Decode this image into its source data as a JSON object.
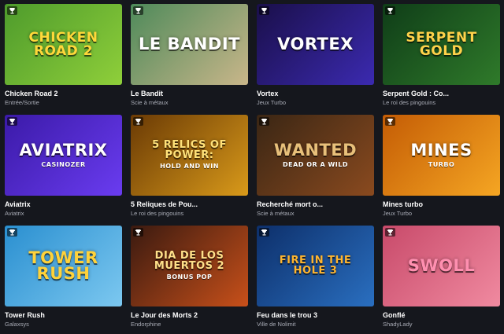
{
  "games": [
    {
      "title": "Chicken Road 2",
      "provider": "Entrée/Sortie",
      "art_text": "Chicken Road 2",
      "icon": "trophy-icon",
      "bg": "#4e9b2c",
      "bg2": "#8fcf3a",
      "fg": "#ffd83a"
    },
    {
      "title": "Le Bandit",
      "provider": "Scie à métaux",
      "art_text": "Le Bandit",
      "icon": "trophy-icon",
      "bg": "#4e8a5a",
      "bg2": "#c9b68a",
      "fg": "#ffffff"
    },
    {
      "title": "Vortex",
      "provider": "Jeux Turbo",
      "art_text": "Vortex",
      "icon": "trophy-icon",
      "bg": "#1a0f4a",
      "bg2": "#3b2ab0",
      "fg": "#ffffff"
    },
    {
      "title": "Serpent Gold : Co...",
      "provider": "Le roi des pingouins",
      "art_text": "Serpent Gold",
      "icon": "trophy-icon",
      "bg": "#0f3d18",
      "bg2": "#2f7a2a",
      "fg": "#ffd24a"
    },
    {
      "title": "Aviatrix",
      "provider": "Aviatrix",
      "art_text": "Aviatrix",
      "sub_text": "Casinozer",
      "icon": "trophy-icon",
      "bg": "#3b1aa8",
      "bg2": "#6a3cf0",
      "fg": "#ffffff"
    },
    {
      "title": "5 Reliques de Pou...",
      "provider": "Le roi des pingouins",
      "art_text": "5 Relics of Power:",
      "sub_text": "Hold and Win",
      "icon": "trophy-icon",
      "bg": "#6a3a05",
      "bg2": "#d99a1a",
      "fg": "#ffe27a"
    },
    {
      "title": "Recherché mort o...",
      "provider": "Scie à métaux",
      "art_text": "Wanted",
      "sub_text": "Dead or a Wild",
      "icon": "trophy-icon",
      "bg": "#3a2614",
      "bg2": "#8a4a1f",
      "fg": "#e8c07a"
    },
    {
      "title": "Mines turbo",
      "provider": "Jeux Turbo",
      "art_text": "Mines",
      "sub_text": "Turbo",
      "icon": "trophy-icon",
      "bg": "#c45c05",
      "bg2": "#f5a623",
      "fg": "#ffffff"
    },
    {
      "title": "Tower Rush",
      "provider": "Galaxsys",
      "art_text": "Tower Rush",
      "icon": "trophy-icon",
      "bg": "#2a8fd0",
      "bg2": "#7cc8f0",
      "fg": "#ffd23a"
    },
    {
      "title": "Le Jour des Morts 2",
      "provider": "Endorphine",
      "art_text": "Dia de los Muertos 2",
      "sub_text": "Bonus Pop",
      "icon": "trophy-icon",
      "bg": "#3a1a10",
      "bg2": "#c8501a",
      "fg": "#ffe08a"
    },
    {
      "title": "Feu dans le trou 3",
      "provider": "Ville de Nolimit",
      "art_text": "Fire in the Hole 3",
      "icon": "trophy-icon",
      "bg": "#0d2f6a",
      "bg2": "#2a6fc0",
      "fg": "#ffb52e"
    },
    {
      "title": "Gonflé",
      "provider": "ShadyLady",
      "art_text": "Swoll",
      "icon": "trophy-icon",
      "bg": "#c84a6a",
      "bg2": "#f08aa0",
      "fg": "#ff8fb0"
    }
  ]
}
